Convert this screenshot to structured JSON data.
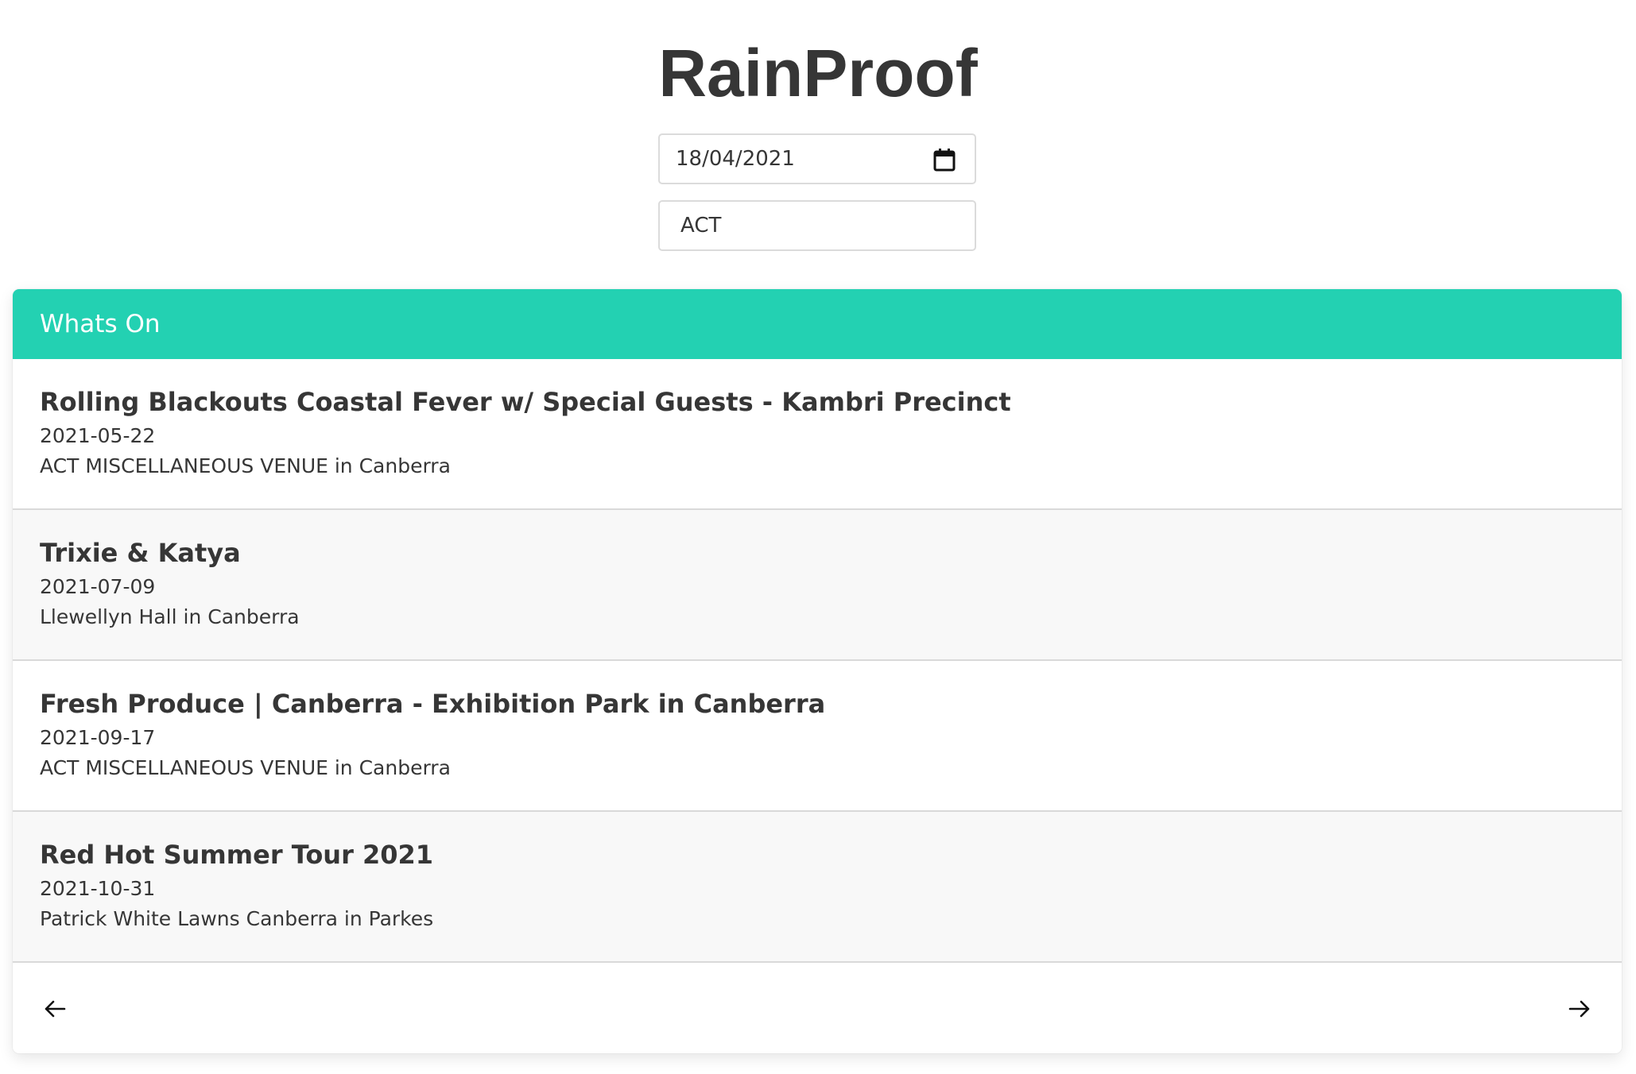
{
  "app": {
    "title": "RainProof"
  },
  "filters": {
    "date_value": "18/04/2021",
    "state_value": "ACT"
  },
  "panel": {
    "heading": "Whats On",
    "events": [
      {
        "title": "Rolling Blackouts Coastal Fever w/ Special Guests - Kambri Precinct",
        "date": "2021-05-22",
        "venue": "ACT MISCELLANEOUS VENUE in Canberra"
      },
      {
        "title": "Trixie & Katya",
        "date": "2021-07-09",
        "venue": "Llewellyn Hall in Canberra"
      },
      {
        "title": "Fresh Produce | Canberra - Exhibition Park in Canberra",
        "date": "2021-09-17",
        "venue": "ACT MISCELLANEOUS VENUE in Canberra"
      },
      {
        "title": "Red Hot Summer Tour 2021",
        "date": "2021-10-31",
        "venue": "Patrick White Lawns Canberra in Parkes"
      }
    ],
    "footer": {
      "prev_icon": "arrow-left-icon",
      "next_icon": "arrow-right-icon"
    }
  },
  "colors": {
    "accent": "#23d1b2",
    "text": "#363636",
    "alt_row": "#f8f8f8"
  }
}
